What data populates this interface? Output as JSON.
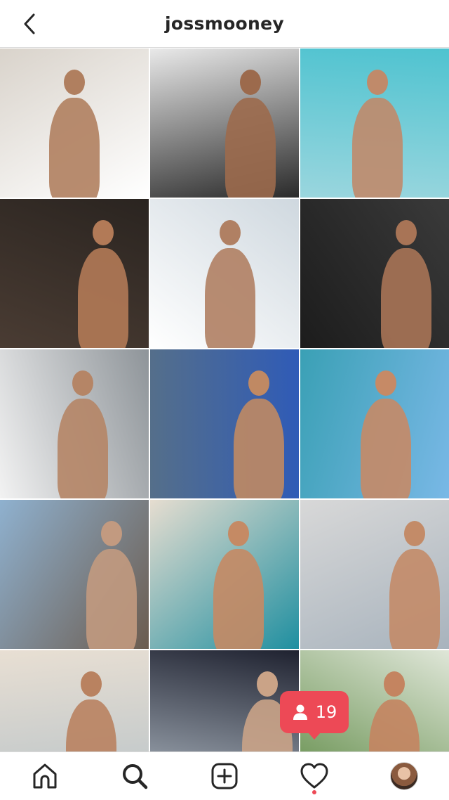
{
  "header": {
    "title": "jossmooney",
    "back_icon": "chevron-left-icon"
  },
  "grid": {
    "posts": [
      {
        "palette": [
          "#d9d3cb",
          "#ffffff",
          "#b07f5f"
        ]
      },
      {
        "palette": [
          "#e9e9e9",
          "#2a2a2a",
          "#9c6a4c"
        ]
      },
      {
        "palette": [
          "#4fc3d0",
          "#9ad6de",
          "#c08a6a"
        ]
      },
      {
        "palette": [
          "#2a2420",
          "#4a3c33",
          "#b27a57"
        ]
      },
      {
        "palette": [
          "#cfd8df",
          "#ffffff",
          "#b08063"
        ]
      },
      {
        "palette": [
          "#3a3a3a",
          "#1c1c1c",
          "#a87456"
        ]
      },
      {
        "palette": [
          "#8e9499",
          "#f2f2f2",
          "#b58566"
        ]
      },
      {
        "palette": [
          "#2f5bb7",
          "#556f8a",
          "#c08963"
        ]
      },
      {
        "palette": [
          "#79b8e6",
          "#3aa0b5",
          "#c68a66"
        ]
      },
      {
        "palette": [
          "#6b5b4e",
          "#8fb1cf",
          "#c29a80"
        ]
      },
      {
        "palette": [
          "#1f8fa0",
          "#e6ddd0",
          "#c58a64"
        ]
      },
      {
        "palette": [
          "#a8b3bd",
          "#d8d8d8",
          "#c38b68"
        ]
      },
      {
        "palette": [
          "#b9c3c8",
          "#e8dfd3",
          "#b98260"
        ]
      },
      {
        "palette": [
          "#aeb8c2",
          "#1f2230",
          "#caa387"
        ]
      },
      {
        "palette": [
          "#5e8a45",
          "#dfe6d8",
          "#c48460"
        ]
      }
    ]
  },
  "notification": {
    "icon": "person-icon",
    "count": "19"
  },
  "bottom_nav": {
    "items": [
      {
        "name": "home",
        "icon": "home-icon"
      },
      {
        "name": "search",
        "icon": "search-icon"
      },
      {
        "name": "new-post",
        "icon": "plus-square-icon"
      },
      {
        "name": "activity",
        "icon": "heart-icon"
      },
      {
        "name": "profile",
        "icon": "avatar"
      }
    ]
  },
  "colors": {
    "accent": "#ed4956",
    "text": "#262626",
    "divider": "#dbdbdb"
  }
}
